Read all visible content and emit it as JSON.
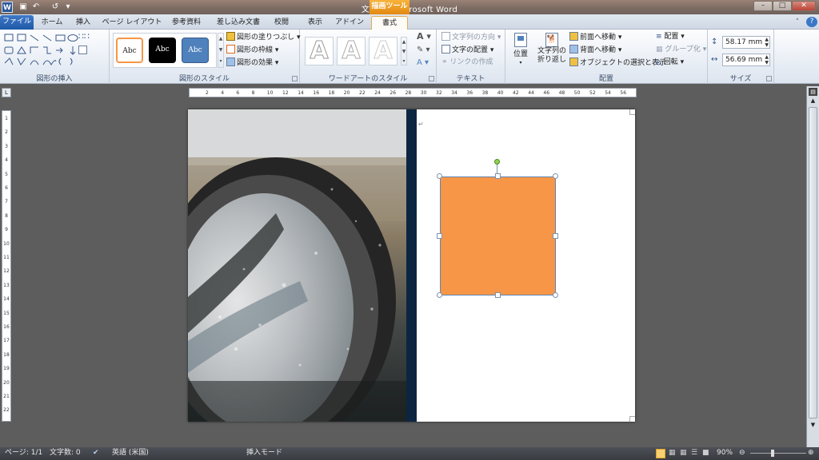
{
  "window": {
    "title": "文書 1 - Microsoft Word",
    "context_tab_header": "描画ツール"
  },
  "quick_access": {
    "app_icon": "W"
  },
  "tabs": [
    {
      "label": "ファイル"
    },
    {
      "label": "ホーム"
    },
    {
      "label": "挿入"
    },
    {
      "label": "ページ レイアウト"
    },
    {
      "label": "参考資料"
    },
    {
      "label": "差し込み文書"
    },
    {
      "label": "校閲"
    },
    {
      "label": "表示"
    },
    {
      "label": "アドイン"
    },
    {
      "label": "書式"
    }
  ],
  "ribbon": {
    "insert_shapes": {
      "label": "図形の挿入"
    },
    "shape_styles": {
      "label": "図形のスタイル",
      "preset_text": "Abc",
      "fill": "図形の塗りつぶし",
      "outline": "図形の枠線",
      "effects": "図形の効果"
    },
    "wordart": {
      "label": "ワードアートのスタイル",
      "letter": "A"
    },
    "text": {
      "label": "テキスト",
      "direction": "文字列の方向",
      "align": "文字の配置",
      "link": "リンクの作成"
    },
    "arrange": {
      "label": "配置",
      "position": "位置",
      "wrap_line1": "文字列の",
      "wrap_line2": "折り返し",
      "bring_forward": "前面へ移動",
      "send_backward": "背面へ移動",
      "selection_pane": "オブジェクトの選択と表示",
      "align": "配置",
      "group": "グループ化",
      "rotate": "回転"
    },
    "size": {
      "label": "サイズ",
      "height": "58.17 mm",
      "width": "56.69 mm"
    }
  },
  "ruler_h": [
    "2",
    "4",
    "6",
    "8",
    "10",
    "12",
    "14",
    "16",
    "18",
    "20",
    "22",
    "24",
    "26",
    "28",
    "30",
    "32",
    "34",
    "36",
    "38",
    "40",
    "42",
    "44",
    "46",
    "48",
    "50",
    "52",
    "54",
    "56"
  ],
  "ruler_v": [
    "1",
    "2",
    "3",
    "4",
    "5",
    "6",
    "7",
    "8",
    "9",
    "10",
    "11",
    "12",
    "13",
    "14",
    "15",
    "16",
    "17",
    "18",
    "19",
    "20",
    "21",
    "22"
  ],
  "statusbar": {
    "page": "ページ: 1/1",
    "words": "文字数: 0",
    "language": "英語 (米国)",
    "mode": "挿入モード",
    "zoom": "90%"
  },
  "colors": {
    "shape_fill": "#f79646",
    "accent_bar": "#0c2642",
    "file_tab": "#2b5797"
  }
}
